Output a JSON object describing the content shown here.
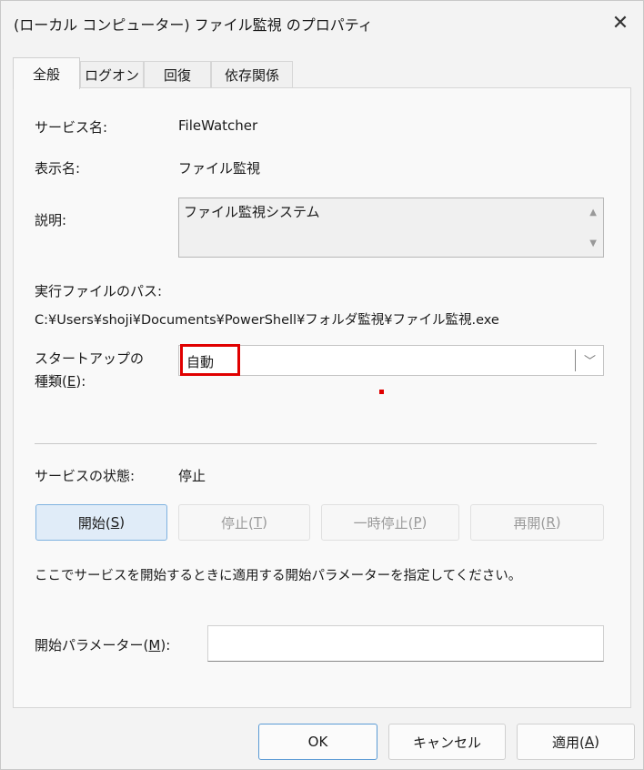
{
  "window": {
    "title": "(ローカル コンピューター) ファイル監視 のプロパティ",
    "close_glyph": "✕"
  },
  "tabs": [
    {
      "label": "全般",
      "active": true
    },
    {
      "label": "ログオン",
      "active": false
    },
    {
      "label": "回復",
      "active": false
    },
    {
      "label": "依存関係",
      "active": false
    }
  ],
  "general": {
    "service_name_label": "サービス名:",
    "service_name_value": "FileWatcher",
    "display_name_label": "表示名:",
    "display_name_value": "ファイル監視",
    "description_label": "説明:",
    "description_value": "ファイル監視システム",
    "exe_path_label": "実行ファイルのパス:",
    "exe_path_value": "C:¥Users¥shoji¥Documents¥PowerShell¥フォルダ監視¥ファイル監視.exe",
    "startup_label_line1": "スタートアップの",
    "startup_label_line2_prefix": "種類(",
    "startup_label_line2_key": "E",
    "startup_label_line2_suffix": "):",
    "startup_value": "自動",
    "status_label": "サービスの状態:",
    "status_value": "停止",
    "buttons": {
      "start_prefix": "開始(",
      "start_key": "S",
      "start_suffix": ")",
      "stop_prefix": "停止(",
      "stop_key": "T",
      "stop_suffix": ")",
      "pause_prefix": "一時停止(",
      "pause_key": "P",
      "pause_suffix": ")",
      "resume_prefix": "再開(",
      "resume_key": "R",
      "resume_suffix": ")"
    },
    "hint_text": "ここでサービスを開始するときに適用する開始パラメーターを指定してください。",
    "param_label_prefix": "開始パラメーター(",
    "param_label_key": "M",
    "param_label_suffix": "):",
    "param_value": ""
  },
  "footer": {
    "ok_label": "OK",
    "cancel_label": "キャンセル",
    "apply_prefix": "適用(",
    "apply_key": "A",
    "apply_suffix": ")"
  },
  "accent": {
    "highlight_color": "#e00000",
    "focus_color": "#5b9bd5"
  }
}
